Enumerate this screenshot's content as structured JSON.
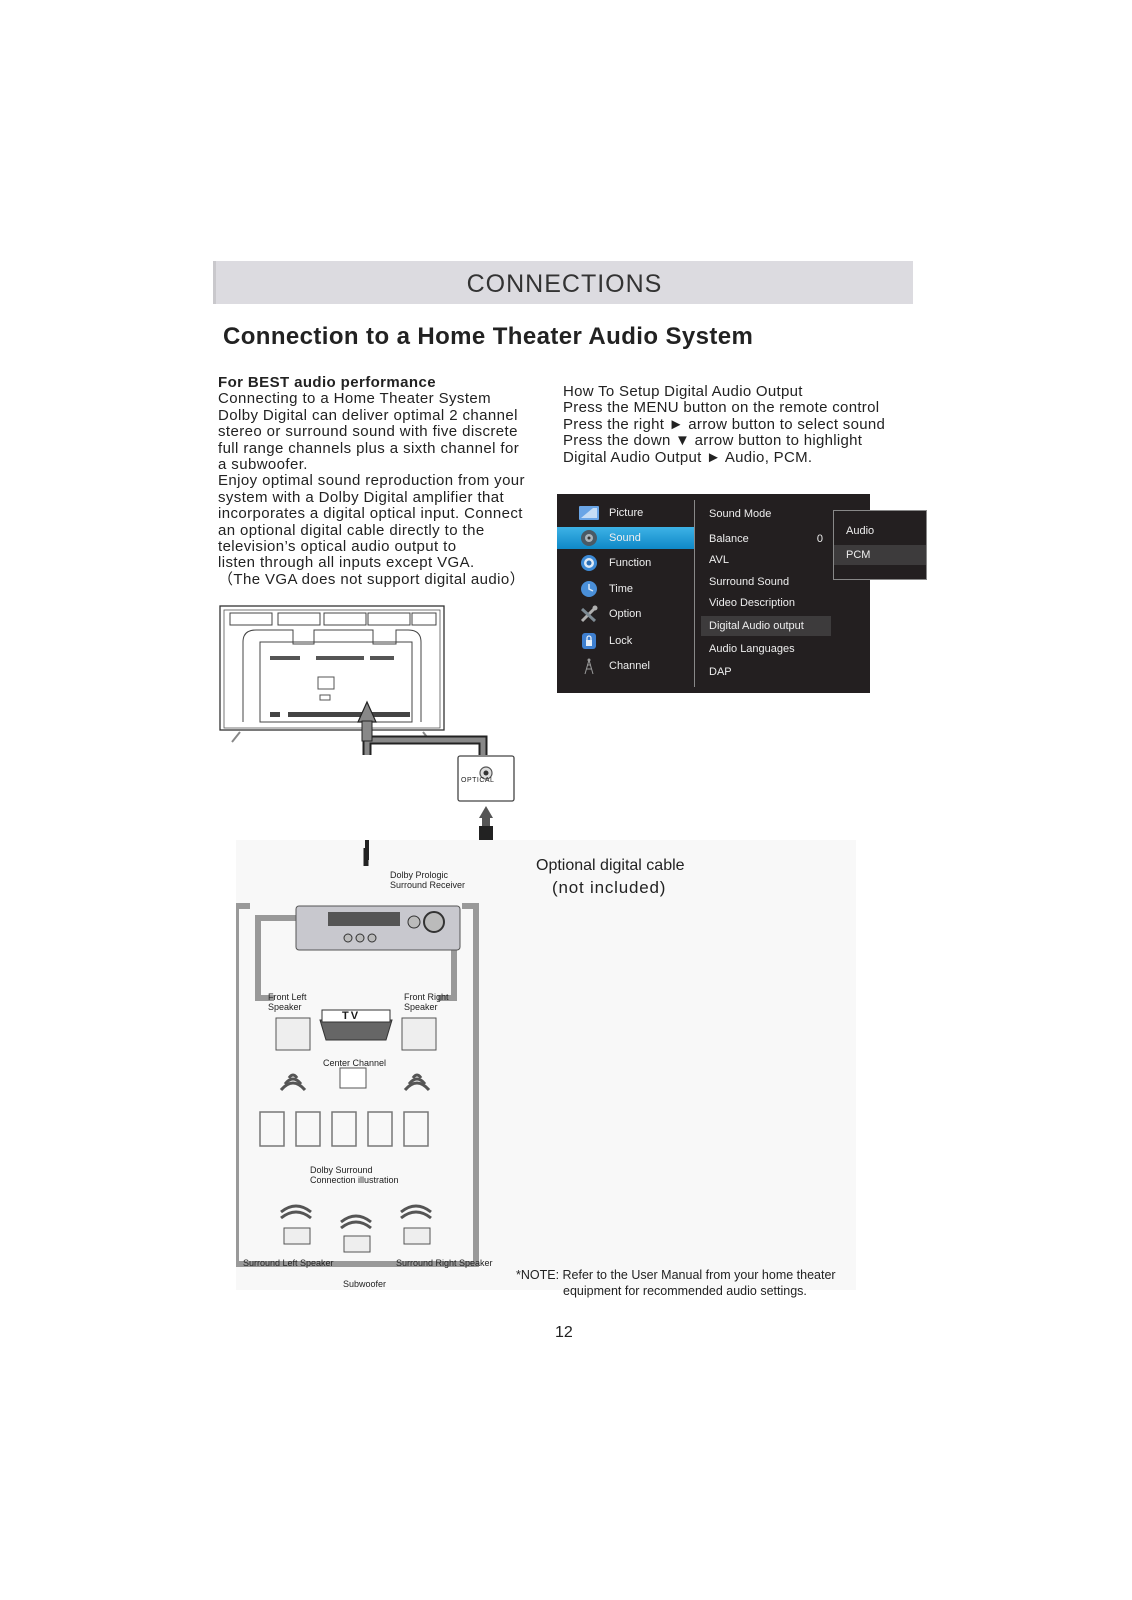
{
  "header": {
    "section_title": "CONNECTIONS"
  },
  "page_title": "Connection to a Home Theater Audio System",
  "left_text": {
    "heading": "For BEST audio performance",
    "lines": [
      "Connecting to a Home Theater System",
      "Dolby Digital can deliver optimal 2 channel",
      "stereo or surround sound with five discrete",
      "full range channels plus a sixth channel for",
      "a subwoofer.",
      "Enjoy optimal sound reproduction from your",
      "system with a Dolby Digital amplifier that",
      "incorporates a digital optical input. Connect",
      " an optional digital cable directly to the",
      "television’s optical  audio output to",
      "listen through all inputs except VGA.",
      "（The VGA does not support digital audio）"
    ]
  },
  "right_text": {
    "lines": [
      "How To Setup Digital Audio Output",
      "Press the MENU button on the remote control",
      "Press the right ► arrow button to select sound",
      "Press the down ▼ arrow button to highlight",
      "Digital Audio Output ► Audio, PCM."
    ]
  },
  "tv_menu": {
    "main_items": [
      {
        "label": "Picture",
        "icon": "picture-icon",
        "active": false
      },
      {
        "label": "Sound",
        "icon": "speaker-icon",
        "active": true
      },
      {
        "label": "Function",
        "icon": "gear-icon",
        "active": false
      },
      {
        "label": "Time",
        "icon": "clock-icon",
        "active": false
      },
      {
        "label": "Option",
        "icon": "wrench-icon",
        "active": false
      },
      {
        "label": "Lock",
        "icon": "lock-icon",
        "active": false
      },
      {
        "label": "Channel",
        "icon": "antenna-icon",
        "active": false
      }
    ],
    "sub_items": [
      {
        "label": "Sound Mode",
        "value": ""
      },
      {
        "label": "Balance",
        "value": "0"
      },
      {
        "label": "AVL",
        "value": ""
      },
      {
        "label": "Surround Sound",
        "value": ""
      },
      {
        "label": "Video Description",
        "value": ""
      },
      {
        "label": "Digital Audio output",
        "value": "",
        "highlighted": true
      },
      {
        "label": "Audio Languages",
        "value": ""
      },
      {
        "label": "DAP",
        "value": ""
      }
    ],
    "popup_options": [
      {
        "label": "Audio",
        "selected": false
      },
      {
        "label": "PCM",
        "selected": true
      }
    ]
  },
  "diagram": {
    "optical_port_label": "OPTICAL",
    "receiver_label_1": "Dolby Prologic",
    "receiver_label_2": "Surround Receiver",
    "tv_label": "TV",
    "front_left_1": "Front Left",
    "front_left_2": "Speaker",
    "front_right_1": "Front Right",
    "front_right_2": "Speaker",
    "center_channel": "Center Channel",
    "dolby_surround_1": "Dolby Surround",
    "dolby_surround_2": "Connection illustration",
    "surround_left": "Surround Left Speaker",
    "surround_right": "Surround Right Speaker",
    "subwoofer": "Subwoofer",
    "cable_caption_1": "Optional digital cable",
    "cable_caption_2": "(not included)"
  },
  "note": {
    "line1": "*NOTE: Refer to the User Manual from your home theater",
    "line2": "equipment for recommended audio settings."
  },
  "page_number": "12"
}
